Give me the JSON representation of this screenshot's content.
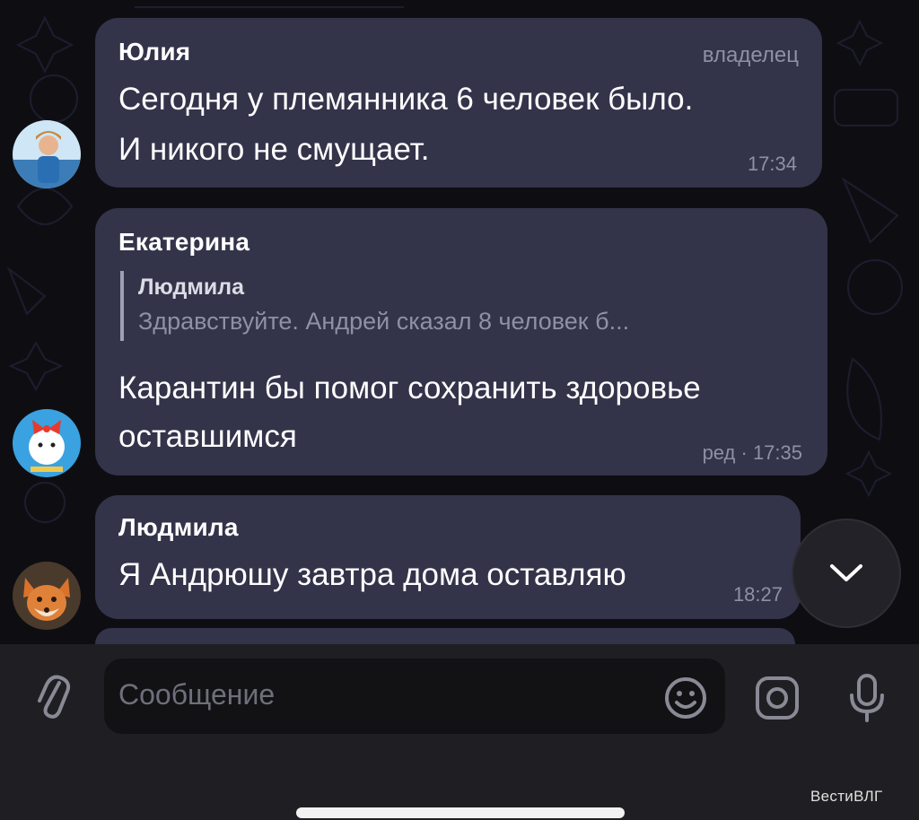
{
  "messages": [
    {
      "sender": "Юлия",
      "role": "владелец",
      "lines": [
        "Сегодня у племянника 6 человек было.",
        "И никого не смущает."
      ],
      "time": "17:34"
    },
    {
      "sender": "Екатерина",
      "reply": {
        "name": "Людмила",
        "text": "Здравствуйте. Андрей сказал 8 человек б..."
      },
      "lines": [
        "Карантин бы помог сохранить здоровье",
        "оставшимся"
      ],
      "time": "ред · 17:35"
    },
    {
      "sender": "Людмила",
      "lines": [
        "Я Андрюшу завтра дома оставляю"
      ],
      "time": "18:27"
    }
  ],
  "input": {
    "placeholder": "Сообщение"
  },
  "icons": {
    "attach": "paperclip-icon",
    "emoji": "emoji-icon",
    "camera": "camera-icon",
    "mic": "microphone-icon",
    "scroll": "chevron-down-icon"
  },
  "watermark": "ВестиВЛГ",
  "colors": {
    "bubble": "#33334a",
    "background": "#0e0e12",
    "input_bar": "#1f1f23",
    "meta_text": "#8f90a8"
  }
}
